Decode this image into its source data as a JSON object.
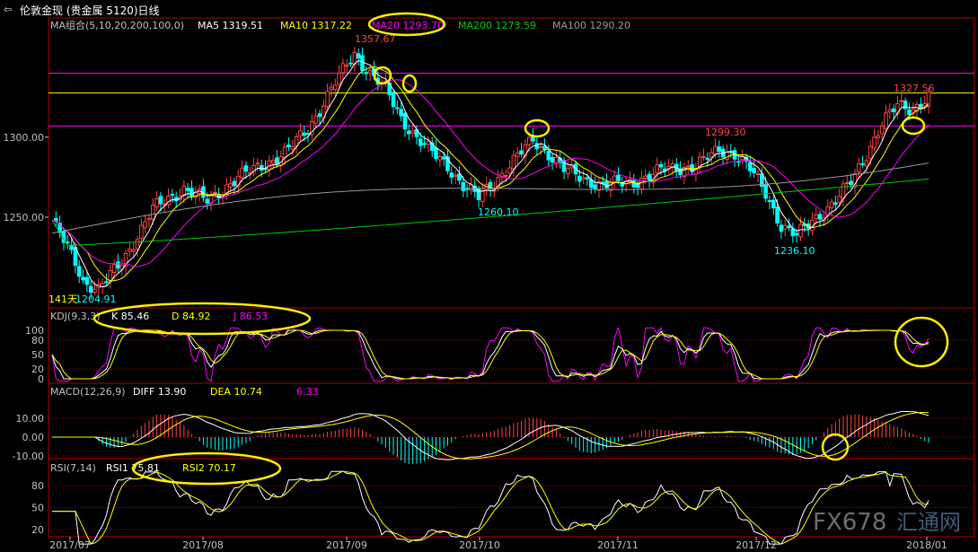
{
  "window": {
    "title": "伦敦金现 (贵金属 5120)日线"
  },
  "colors": {
    "up": "#ff4444",
    "down": "#00ffff",
    "ma5": "#ffffff",
    "ma10": "#ffff00",
    "ma20": "#ff00ff",
    "ma200": "#00cc00",
    "ma100": "#999999",
    "grid": "#b00000",
    "hl": "#ff00ff",
    "hly": "#ffff00",
    "circle": "#ffee00",
    "axis": "#c0c0c0"
  },
  "panels": {
    "price": {
      "legend": [
        {
          "label": "MA组合(5,10,20,200,100,0)",
          "color": "#c0c0c0"
        },
        {
          "label": "MA5 1319.51",
          "color": "#ffffff"
        },
        {
          "label": "MA10 1317.22",
          "color": "#ffff00"
        },
        {
          "label": "MA20 1293.70",
          "color": "#ff00ff"
        },
        {
          "label": "MA200 1273.59",
          "color": "#00cc00"
        },
        {
          "label": "MA100 1290.20",
          "color": "#999999"
        }
      ],
      "yticks": [
        "1300.00",
        "1250.00"
      ],
      "annotations": [
        {
          "text": "1357.67",
          "color": "#ff4444"
        },
        {
          "text": "1327.56",
          "color": "#ff4444"
        },
        {
          "text": "1299.30",
          "color": "#ff4444"
        },
        {
          "text": "1260.10",
          "color": "#00ffff"
        },
        {
          "text": "1236.10",
          "color": "#00ffff"
        },
        {
          "text": "141天",
          "color": "#ffff00"
        },
        {
          "text": "1204.91",
          "color": "#00ffff"
        }
      ]
    },
    "kdj": {
      "legend": [
        {
          "label": "KDJ(9,3,3)",
          "color": "#c0c0c0"
        },
        {
          "label": "K  85.46",
          "color": "#ffffff"
        },
        {
          "label": "D  84.92",
          "color": "#ffff00"
        },
        {
          "label": "J  86.53",
          "color": "#ff00ff"
        }
      ],
      "yticks": [
        "100",
        "80",
        "50",
        "20",
        "0"
      ]
    },
    "macd": {
      "legend": [
        {
          "label": "MACD(12,26,9)",
          "color": "#c0c0c0"
        },
        {
          "label": "DIFF  13.90",
          "color": "#ffffff"
        },
        {
          "label": "DEA  10.74",
          "color": "#ffff00"
        },
        {
          "label": "6.33",
          "color": "#ff00ff"
        }
      ],
      "yticks": [
        "10.00",
        "0.00",
        "-10.00"
      ]
    },
    "rsi": {
      "legend": [
        {
          "label": "RSI(7,14)",
          "color": "#c0c0c0"
        },
        {
          "label": "RSI1  75.81",
          "color": "#ffffff"
        },
        {
          "label": "RSI2  70.17",
          "color": "#ffff00"
        }
      ],
      "yticks": [
        "80",
        "50",
        "20"
      ]
    }
  },
  "xaxis": {
    "labels": [
      "2017/07",
      "2017/08",
      "2017/09",
      "2017/10",
      "2017/11",
      "2017/12",
      "2018/01"
    ]
  },
  "watermark": {
    "text": "FX678",
    "text2": "汇通网"
  },
  "chart_data": {
    "type": "candlestick",
    "title": "伦敦金现 (贵金属 5120)日线",
    "ylim": [
      1195,
      1370
    ],
    "key_levels": [
      1340,
      1327.56,
      1307
    ],
    "price_anchors": [
      {
        "x": "2017/07",
        "y": 1248
      },
      {
        "x": "2017/07",
        "y": 1204.91
      },
      {
        "x": "2017/08",
        "y": 1268
      },
      {
        "x": "2017/09",
        "y": 1357.67
      },
      {
        "x": "2017/10",
        "y": 1260.1
      },
      {
        "x": "2017/10",
        "y": 1300
      },
      {
        "x": "2017/11",
        "y": 1280
      },
      {
        "x": "2017/11",
        "y": 1299.3
      },
      {
        "x": "2017/12",
        "y": 1236.1
      },
      {
        "x": "2018/01",
        "y": 1327.56
      }
    ],
    "indicators": {
      "MA5": 1319.51,
      "MA10": 1317.22,
      "MA20": 1293.7,
      "MA200": 1273.59,
      "MA100": 1290.2,
      "KDJ": {
        "K": 85.46,
        "D": 84.92,
        "J": 86.53
      },
      "MACD": {
        "DIFF": 13.9,
        "DEA": 10.74,
        "MACD": 6.33
      },
      "RSI": {
        "RSI1": 75.81,
        "RSI2": 70.17
      }
    }
  }
}
